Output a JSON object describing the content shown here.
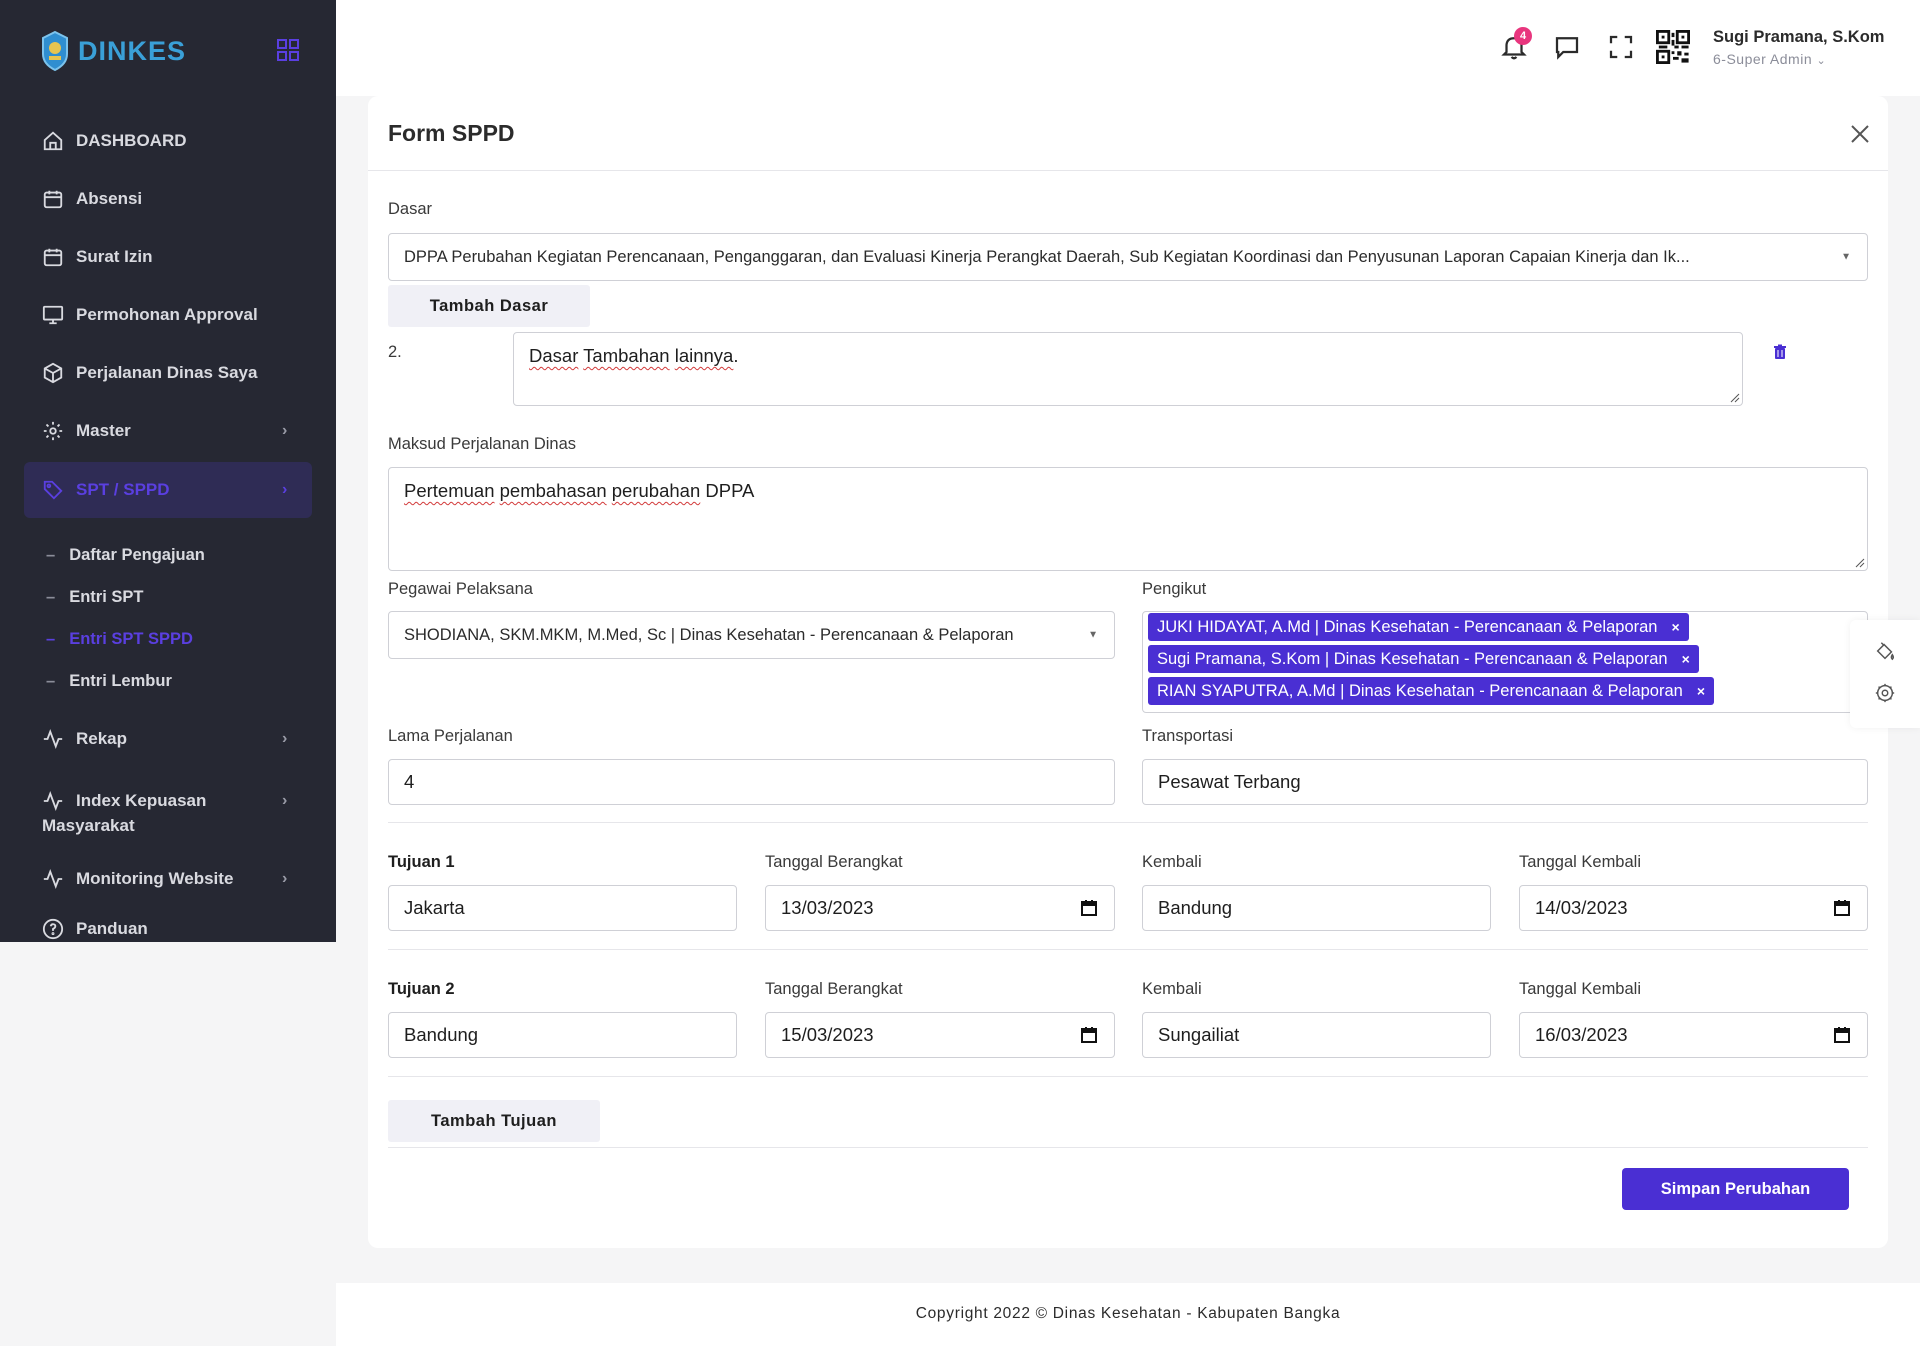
{
  "brand": {
    "name": "DINKES"
  },
  "sidebar": {
    "items": [
      {
        "label": "DASHBOARD"
      },
      {
        "label": "Absensi"
      },
      {
        "label": "Surat Izin"
      },
      {
        "label": "Permohonan Approval"
      },
      {
        "label": "Perjalanan Dinas Saya"
      },
      {
        "label": "Master"
      },
      {
        "label": "SPT / SPPD"
      }
    ],
    "sub_items": [
      {
        "label": "Daftar Pengajuan"
      },
      {
        "label": "Entri SPT"
      },
      {
        "label": "Entri SPT SPPD"
      },
      {
        "label": "Entri Lembur"
      }
    ],
    "items_after": [
      {
        "label": "Rekap"
      },
      {
        "label": "Index Kepuasan",
        "label2": "Masyarakat"
      },
      {
        "label": "Monitoring Website"
      },
      {
        "label": "Panduan"
      }
    ]
  },
  "topbar": {
    "notification_count": "4",
    "user_name": "Sugi Pramana, S.Kom",
    "user_role": "6-Super Admin"
  },
  "form": {
    "title": "Form SPPD",
    "dasar_label": "Dasar",
    "dasar_value": "DPPA Perubahan Kegiatan Perencanaan, Penganggaran, dan Evaluasi Kinerja Perangkat Daerah, Sub Kegiatan Koordinasi dan Penyusunan Laporan Capaian Kinerja dan Ik...",
    "tambah_dasar": "Tambah Dasar",
    "dasar_extra_number": "2.",
    "dasar_extra_words": [
      "Dasar",
      "Tambahan",
      "lainnya"
    ],
    "dasar_extra_tail": ".",
    "maksud_label": "Maksud Perjalanan Dinas",
    "maksud_words": [
      "Pertemuan",
      "pembahasan",
      "perubahan"
    ],
    "maksud_tail": "DPPA",
    "pegawai_label": "Pegawai Pelaksana",
    "pegawai_value": "SHODIANA, SKM.MKM, M.Med, Sc | Dinas Kesehatan - Perencanaan & Pelaporan",
    "pengikut_label": "Pengikut",
    "pengikut": [
      "JUKI HIDAYAT, A.Md | Dinas Kesehatan - Perencanaan & Pelaporan",
      "Sugi Pramana, S.Kom | Dinas Kesehatan - Perencanaan & Pelaporan",
      "RIAN SYAPUTRA, A.Md | Dinas Kesehatan - Perencanaan & Pelaporan"
    ],
    "tag_remove": "×",
    "lama_label": "Lama Perjalanan",
    "lama_value": "4",
    "transportasi_label": "Transportasi",
    "transportasi_value": "Pesawat Terbang",
    "tujuan": [
      {
        "label": "Tujuan 1",
        "tujuan": "Jakarta",
        "berangkat_label": "Tanggal Berangkat",
        "berangkat": "13/03/2023",
        "kembali_label": "Kembali",
        "kembali": "Bandung",
        "tgl_kembali_label": "Tanggal Kembali",
        "tgl_kembali": "14/03/2023"
      },
      {
        "label": "Tujuan 2",
        "tujuan": "Bandung",
        "berangkat_label": "Tanggal Berangkat",
        "berangkat": "15/03/2023",
        "kembali_label": "Kembali",
        "kembali": "Sungailiat",
        "tgl_kembali_label": "Tanggal Kembali",
        "tgl_kembali": "16/03/2023"
      }
    ],
    "tambah_tujuan": "Tambah Tujuan",
    "simpan": "Simpan Perubahan"
  },
  "footer": {
    "text": "Copyright 2022 © Dinas Kesehatan - Kabupaten Bangka"
  }
}
